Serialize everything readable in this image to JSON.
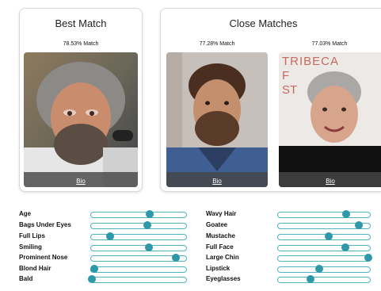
{
  "best_match": {
    "title": "Best Match",
    "match_text": "78.53% Match",
    "bio_label": "Bio"
  },
  "close_matches": {
    "title": "Close Matches",
    "items": [
      {
        "match_text": "77.28% Match",
        "bio_label": "Bio"
      },
      {
        "match_text": "77.03% Match",
        "bio_label": "Bio",
        "photo_sign_text": "TRIBECA F ST"
      }
    ]
  },
  "attributes_left": [
    {
      "label": "Age",
      "level": 0.62
    },
    {
      "label": "Bags Under Eyes",
      "level": 0.59
    },
    {
      "label": "Full Lips",
      "level": 0.2
    },
    {
      "label": "Smiling",
      "level": 0.61
    },
    {
      "label": "Prominent Nose",
      "level": 0.89
    },
    {
      "label": "Blond Hair",
      "level": 0.03
    },
    {
      "label": "Bald",
      "level": 0.01
    }
  ],
  "attributes_right": [
    {
      "label": "Wavy Hair",
      "level": 0.74
    },
    {
      "label": "Goatee",
      "level": 0.88
    },
    {
      "label": "Mustache",
      "level": 0.55
    },
    {
      "label": "Full Face",
      "level": 0.73
    },
    {
      "label": "Large Chin",
      "level": 0.98
    },
    {
      "label": "Lipstick",
      "level": 0.45
    },
    {
      "label": "Eyeglasses",
      "level": 0.35
    }
  ],
  "colors": {
    "slider_track_border": "#4fb3c0",
    "slider_thumb": "#2e97a8",
    "bio_bar": "#464646"
  }
}
